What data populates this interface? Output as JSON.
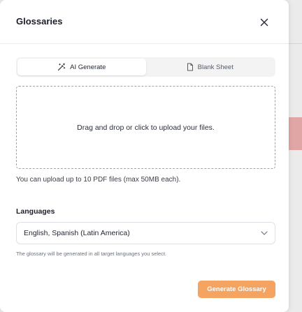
{
  "modal": {
    "title": "Glossaries",
    "close_icon": "close-icon"
  },
  "tabs": [
    {
      "label": "AI Generate",
      "icon": "magic-wand-icon",
      "active": true
    },
    {
      "label": "Blank Sheet",
      "icon": "file-icon",
      "active": false
    }
  ],
  "upload": {
    "dropzone_text": "Drag and drop or click to upload your files.",
    "hint": "You can upload up to 10 PDF files (max 50MB each)."
  },
  "languages": {
    "label": "Languages",
    "selected": "English, Spanish (Latin America)",
    "helper": "The glossary will be generated in all target languages you select.",
    "dropdown_icon": "chevron-down-icon"
  },
  "actions": {
    "generate_label": "Generate Glossary"
  },
  "colors": {
    "accent": "#f5a361",
    "backdrop": "#ebebeb",
    "backdrop_highlight": "#e0a6a6"
  }
}
